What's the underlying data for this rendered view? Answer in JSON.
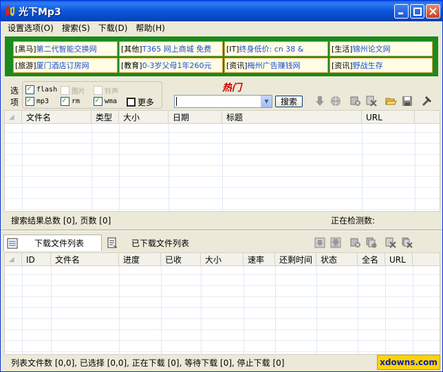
{
  "window": {
    "title": "光下Mp3"
  },
  "menu": [
    {
      "label": "设置选项(O)"
    },
    {
      "label": "搜索(S)"
    },
    {
      "label": "下载(D)"
    },
    {
      "label": "帮助(H)"
    }
  ],
  "ads": [
    {
      "tag": "[黑马]",
      "text": "第二代智能交换网"
    },
    {
      "tag": "[其他]",
      "text": "T365 网上商城 免费"
    },
    {
      "tag": "[IT]",
      "text": "终身低价: cn 38 &"
    },
    {
      "tag": "[生活]",
      "text": "锦州论文网"
    },
    {
      "tag": "[旅游]",
      "text": "厦门酒店订房网"
    },
    {
      "tag": "[教育]",
      "text": "0-3岁父母1年260元"
    },
    {
      "tag": "[资讯]",
      "text": "梅州广告赚钱网"
    },
    {
      "tag": "[资讯]",
      "text": "野战生存"
    }
  ],
  "options": {
    "label_top": "选",
    "label_bottom": "项",
    "checkboxes": [
      {
        "label": "flash",
        "checked": true,
        "disabled": false
      },
      {
        "label": "图片",
        "checked": false,
        "disabled": true
      },
      {
        "label": "铃声",
        "checked": false,
        "disabled": true
      },
      {
        "label": "mp3",
        "checked": true,
        "disabled": false
      },
      {
        "label": "rm",
        "checked": true,
        "disabled": false
      },
      {
        "label": "wma",
        "checked": true,
        "disabled": false
      },
      {
        "label": "更多",
        "checked": false,
        "disabled": false
      }
    ]
  },
  "search": {
    "hot_label": "热门",
    "input_value": "",
    "button_label": "搜索"
  },
  "results_table": {
    "columns": [
      "文件名",
      "类型",
      "大小",
      "日期",
      "标题",
      "URL"
    ]
  },
  "results_status": {
    "summary": "搜索结果总数 [0], 页数 [0]",
    "checking": "正在检测数:"
  },
  "tabs": [
    {
      "label": "下载文件列表",
      "active": true
    },
    {
      "label": "已下载文件列表",
      "active": false
    }
  ],
  "download_table": {
    "columns": [
      "ID",
      "文件名",
      "进度",
      "已收",
      "大小",
      "速率",
      "还剩时间",
      "状态",
      "全名",
      "URL"
    ]
  },
  "download_status": {
    "summary": "列表文件数 [0,0], 已选择 [0,0], 正在下载 [0], 等待下载 [0], 停止下载 [0]",
    "brand": "xdowns.com"
  }
}
